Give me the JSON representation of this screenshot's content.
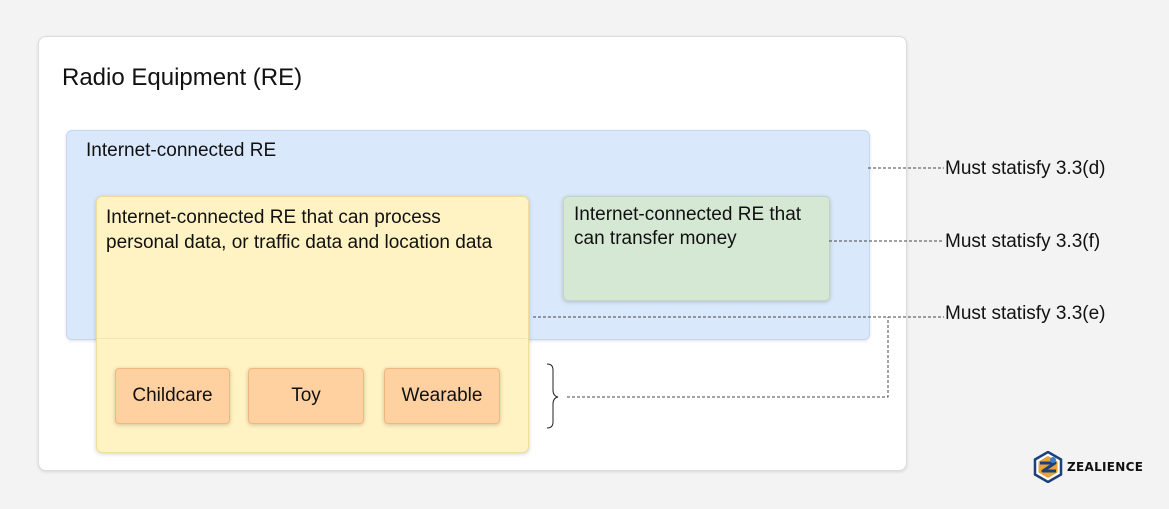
{
  "diagram": {
    "outer_title": "Radio Equipment (RE)",
    "blue_title": "Internet-connected RE",
    "yellow_title": "Internet-connected RE that can process personal data, or traffic data and location data",
    "green_title": "Internet-connected RE that can transfer money",
    "categories": [
      "Childcare",
      "Toy",
      "Wearable"
    ],
    "requirements": {
      "d": "Must statisfy 3.3(d)",
      "f": "Must statisfy 3.3(f)",
      "e": "Must statisfy 3.3(e)"
    },
    "colors": {
      "blue_box": "#dae8fc",
      "yellow_box": "#fff2c3",
      "green_box": "#d5e8d4",
      "orange_chip": "#ffd1a1"
    }
  },
  "brand": {
    "name": "ZEALIENCE",
    "icon": "zealience-logo-icon"
  }
}
